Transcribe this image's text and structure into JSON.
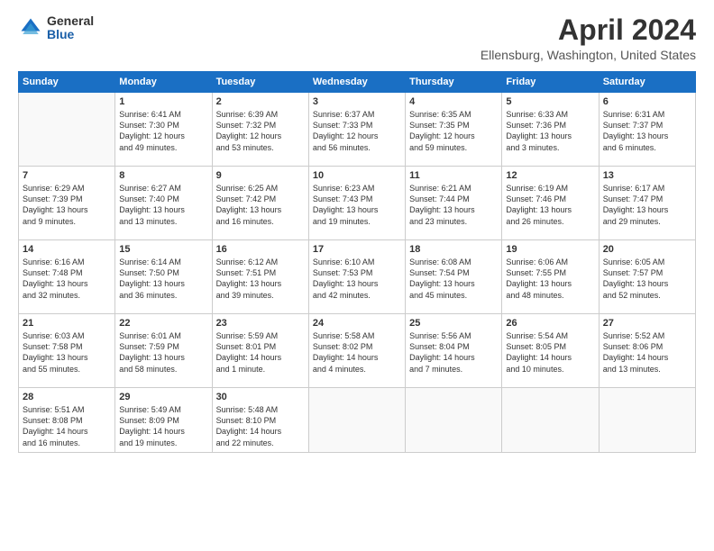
{
  "logo": {
    "general": "General",
    "blue": "Blue"
  },
  "title": "April 2024",
  "location": "Ellensburg, Washington, United States",
  "days_of_week": [
    "Sunday",
    "Monday",
    "Tuesday",
    "Wednesday",
    "Thursday",
    "Friday",
    "Saturday"
  ],
  "weeks": [
    [
      {
        "day": "",
        "info": ""
      },
      {
        "day": "1",
        "info": "Sunrise: 6:41 AM\nSunset: 7:30 PM\nDaylight: 12 hours\nand 49 minutes."
      },
      {
        "day": "2",
        "info": "Sunrise: 6:39 AM\nSunset: 7:32 PM\nDaylight: 12 hours\nand 53 minutes."
      },
      {
        "day": "3",
        "info": "Sunrise: 6:37 AM\nSunset: 7:33 PM\nDaylight: 12 hours\nand 56 minutes."
      },
      {
        "day": "4",
        "info": "Sunrise: 6:35 AM\nSunset: 7:35 PM\nDaylight: 12 hours\nand 59 minutes."
      },
      {
        "day": "5",
        "info": "Sunrise: 6:33 AM\nSunset: 7:36 PM\nDaylight: 13 hours\nand 3 minutes."
      },
      {
        "day": "6",
        "info": "Sunrise: 6:31 AM\nSunset: 7:37 PM\nDaylight: 13 hours\nand 6 minutes."
      }
    ],
    [
      {
        "day": "7",
        "info": "Sunrise: 6:29 AM\nSunset: 7:39 PM\nDaylight: 13 hours\nand 9 minutes."
      },
      {
        "day": "8",
        "info": "Sunrise: 6:27 AM\nSunset: 7:40 PM\nDaylight: 13 hours\nand 13 minutes."
      },
      {
        "day": "9",
        "info": "Sunrise: 6:25 AM\nSunset: 7:42 PM\nDaylight: 13 hours\nand 16 minutes."
      },
      {
        "day": "10",
        "info": "Sunrise: 6:23 AM\nSunset: 7:43 PM\nDaylight: 13 hours\nand 19 minutes."
      },
      {
        "day": "11",
        "info": "Sunrise: 6:21 AM\nSunset: 7:44 PM\nDaylight: 13 hours\nand 23 minutes."
      },
      {
        "day": "12",
        "info": "Sunrise: 6:19 AM\nSunset: 7:46 PM\nDaylight: 13 hours\nand 26 minutes."
      },
      {
        "day": "13",
        "info": "Sunrise: 6:17 AM\nSunset: 7:47 PM\nDaylight: 13 hours\nand 29 minutes."
      }
    ],
    [
      {
        "day": "14",
        "info": "Sunrise: 6:16 AM\nSunset: 7:48 PM\nDaylight: 13 hours\nand 32 minutes."
      },
      {
        "day": "15",
        "info": "Sunrise: 6:14 AM\nSunset: 7:50 PM\nDaylight: 13 hours\nand 36 minutes."
      },
      {
        "day": "16",
        "info": "Sunrise: 6:12 AM\nSunset: 7:51 PM\nDaylight: 13 hours\nand 39 minutes."
      },
      {
        "day": "17",
        "info": "Sunrise: 6:10 AM\nSunset: 7:53 PM\nDaylight: 13 hours\nand 42 minutes."
      },
      {
        "day": "18",
        "info": "Sunrise: 6:08 AM\nSunset: 7:54 PM\nDaylight: 13 hours\nand 45 minutes."
      },
      {
        "day": "19",
        "info": "Sunrise: 6:06 AM\nSunset: 7:55 PM\nDaylight: 13 hours\nand 48 minutes."
      },
      {
        "day": "20",
        "info": "Sunrise: 6:05 AM\nSunset: 7:57 PM\nDaylight: 13 hours\nand 52 minutes."
      }
    ],
    [
      {
        "day": "21",
        "info": "Sunrise: 6:03 AM\nSunset: 7:58 PM\nDaylight: 13 hours\nand 55 minutes."
      },
      {
        "day": "22",
        "info": "Sunrise: 6:01 AM\nSunset: 7:59 PM\nDaylight: 13 hours\nand 58 minutes."
      },
      {
        "day": "23",
        "info": "Sunrise: 5:59 AM\nSunset: 8:01 PM\nDaylight: 14 hours\nand 1 minute."
      },
      {
        "day": "24",
        "info": "Sunrise: 5:58 AM\nSunset: 8:02 PM\nDaylight: 14 hours\nand 4 minutes."
      },
      {
        "day": "25",
        "info": "Sunrise: 5:56 AM\nSunset: 8:04 PM\nDaylight: 14 hours\nand 7 minutes."
      },
      {
        "day": "26",
        "info": "Sunrise: 5:54 AM\nSunset: 8:05 PM\nDaylight: 14 hours\nand 10 minutes."
      },
      {
        "day": "27",
        "info": "Sunrise: 5:52 AM\nSunset: 8:06 PM\nDaylight: 14 hours\nand 13 minutes."
      }
    ],
    [
      {
        "day": "28",
        "info": "Sunrise: 5:51 AM\nSunset: 8:08 PM\nDaylight: 14 hours\nand 16 minutes."
      },
      {
        "day": "29",
        "info": "Sunrise: 5:49 AM\nSunset: 8:09 PM\nDaylight: 14 hours\nand 19 minutes."
      },
      {
        "day": "30",
        "info": "Sunrise: 5:48 AM\nSunset: 8:10 PM\nDaylight: 14 hours\nand 22 minutes."
      },
      {
        "day": "",
        "info": ""
      },
      {
        "day": "",
        "info": ""
      },
      {
        "day": "",
        "info": ""
      },
      {
        "day": "",
        "info": ""
      }
    ]
  ]
}
